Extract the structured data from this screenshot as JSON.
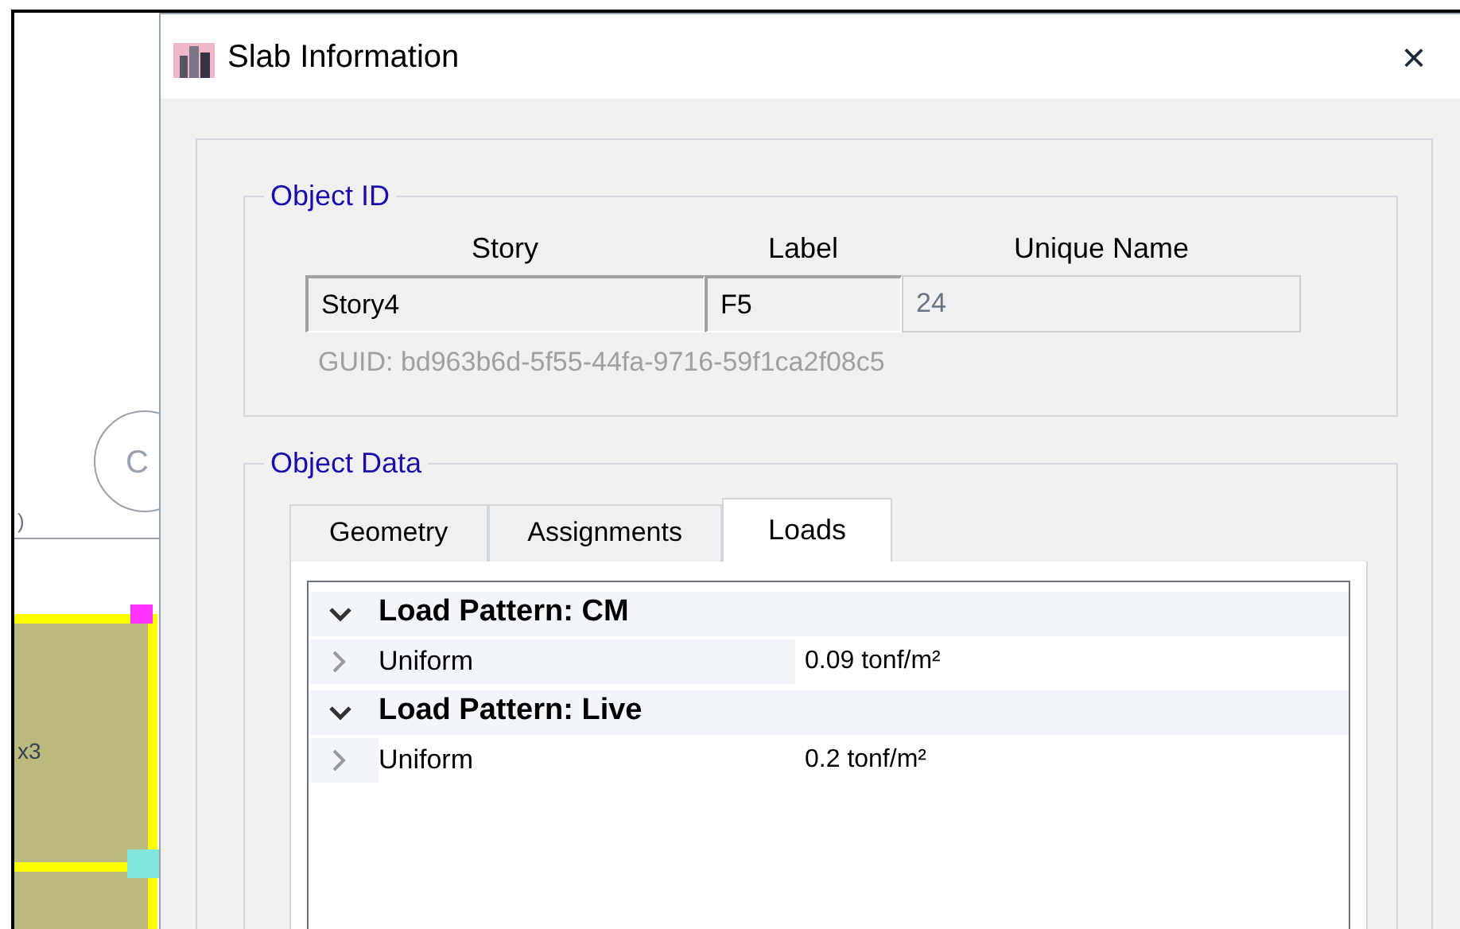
{
  "background": {
    "grid_bubble": "C",
    "dimension_mark": ")",
    "slab_label": "x3"
  },
  "window": {
    "title": "Slab Information",
    "close": "×"
  },
  "object_id": {
    "title": "Object ID",
    "fields": [
      {
        "heading": "Story",
        "value": "Story4",
        "disabled": false
      },
      {
        "heading": "Label",
        "value": "F5",
        "disabled": false
      },
      {
        "heading": "Unique Name",
        "value": "24",
        "disabled": true
      }
    ],
    "guid": "GUID:  bd963b6d-5f55-44fa-9716-59f1ca2f08c5"
  },
  "object_data": {
    "title": "Object Data",
    "tabs": [
      {
        "label": "Geometry",
        "selected": false
      },
      {
        "label": "Assignments",
        "selected": false
      },
      {
        "label": "Loads",
        "selected": true
      }
    ],
    "groups": [
      {
        "title": "Load Pattern: CM",
        "expanded": true,
        "children": [
          {
            "name": "Uniform",
            "value": "0.09 tonf/m²",
            "selected": false
          }
        ]
      },
      {
        "title": "Load Pattern: Live",
        "expanded": true,
        "children": [
          {
            "name": "Uniform",
            "value": "0.2 tonf/m²",
            "selected": true
          }
        ]
      }
    ]
  }
}
